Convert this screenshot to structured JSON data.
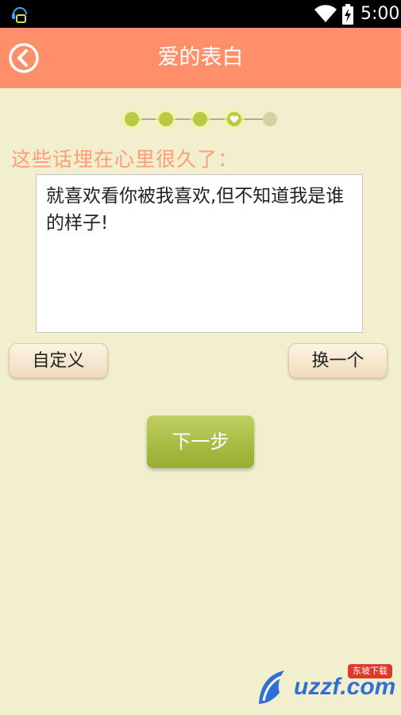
{
  "status_bar": {
    "time": "5:00",
    "left_icon": "headset-bot-icon",
    "wifi_icon": "wifi-icon",
    "battery_icon": "battery-icon"
  },
  "header": {
    "title": "爱的表白",
    "back_icon": "back-arrow-icon"
  },
  "progress": {
    "total_steps": 5,
    "current_step": 4,
    "completed": [
      1,
      2,
      3
    ],
    "active_color": "#d4e860",
    "inactive_color": "#d8cfa6"
  },
  "prompt": {
    "text": "这些话埋在心里很久了："
  },
  "message": {
    "text": "就喜欢看你被我喜欢,但不知道我是谁的样子!"
  },
  "buttons": {
    "custom_label": "自定义",
    "change_label": "换一个",
    "next_label": "下一步"
  },
  "watermark": {
    "logo_text": "uzzf.com",
    "tag_text": "东坡下载"
  },
  "colors": {
    "header": "#ff8f6a",
    "background": "#f2efcf",
    "prompt_text": "#ff9d78",
    "next_button": "#a8bc3d"
  }
}
